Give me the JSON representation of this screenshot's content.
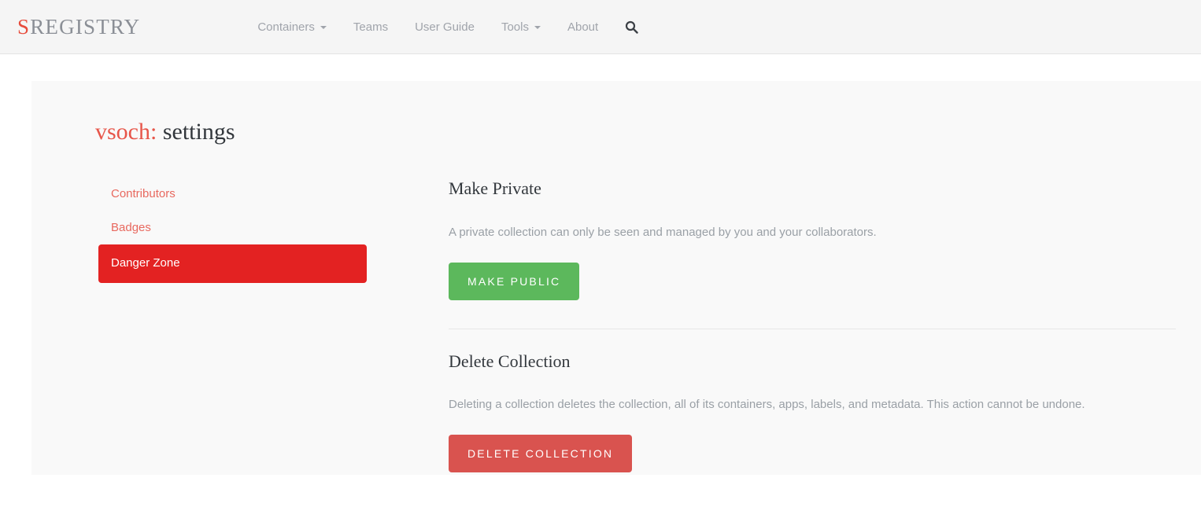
{
  "navbar": {
    "brand": {
      "accent_letter": "S",
      "rest": "REGISTRY",
      "accent_color": "#e74c3c"
    },
    "items": [
      {
        "label": "Containers",
        "has_caret": true
      },
      {
        "label": "Teams",
        "has_caret": false
      },
      {
        "label": "User Guide",
        "has_caret": false
      },
      {
        "label": "Tools",
        "has_caret": true
      },
      {
        "label": "About",
        "has_caret": false
      }
    ],
    "search_icon": "search-icon"
  },
  "page": {
    "owner": "vsoch:",
    "section": "settings"
  },
  "settings_nav": {
    "items": [
      {
        "label": "Contributors",
        "active": false
      },
      {
        "label": "Badges",
        "active": false
      },
      {
        "label": "Danger Zone",
        "active": true
      }
    ]
  },
  "make_private": {
    "heading": "Make Private",
    "description": "A private collection can only be seen and managed by you and your collaborators.",
    "button_label": "Make Public",
    "button_color": "#5cb85c"
  },
  "delete_collection": {
    "heading": "Delete Collection",
    "description": "Deleting a collection deletes the collection, all of its containers, apps, labels, and metadata. This action cannot be undone.",
    "button_label": "Delete Collection",
    "button_color": "#d9534f"
  },
  "colors": {
    "brand_red": "#e74c3c",
    "danger_red": "#e32222",
    "link_coral": "#e8695f",
    "panel_bg": "#f9f9f9",
    "navbar_bg": "#f5f5f5"
  }
}
